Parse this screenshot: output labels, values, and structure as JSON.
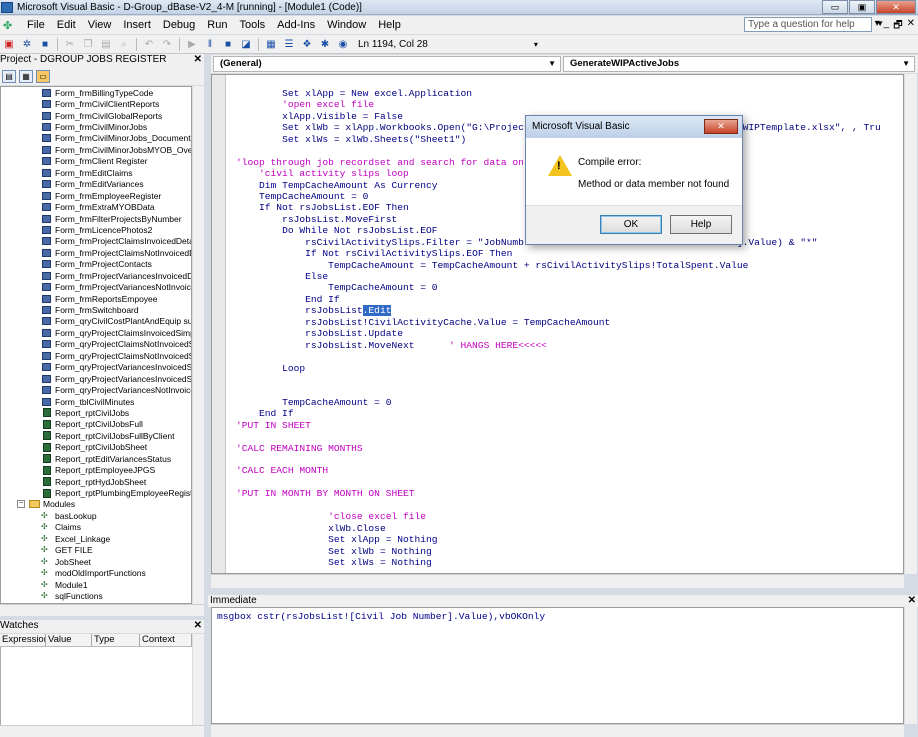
{
  "window": {
    "title": "Microsoft Visual Basic - D-Group_dBase-V2_4-M [running] - [Module1 (Code)]",
    "controls": [
      "▭",
      "▣",
      "✕"
    ]
  },
  "menu": {
    "items": [
      "File",
      "Edit",
      "View",
      "Insert",
      "Debug",
      "Run",
      "Tools",
      "Add-Ins",
      "Window",
      "Help"
    ],
    "ask_placeholder": "Type a question for help",
    "mdi_controls": [
      "▾",
      "_",
      "🗗",
      "✕"
    ]
  },
  "toolbar": {
    "position": "Ln 1194, Col 28"
  },
  "project": {
    "header": "Project - DGROUP JOBS REGISTER",
    "close": "✕",
    "forms": [
      "Form_frmBillingTypeCode",
      "Form_frmCivilClientReports",
      "Form_frmCivilGlobalReports",
      "Form_frmCivilMinorJobs",
      "Form_frmCivilMinorJobs_Documents",
      "Form_frmCivilMinorJobsMYOB_Overvie",
      "Form_frmClient Register",
      "Form_frmEditClaims",
      "Form_frmEditVariances",
      "Form_frmEmployeeRegister",
      "Form_frmExtraMYOBData",
      "Form_frmFilterProjectsByNumber",
      "Form_frmLicencePhotos2",
      "Form_frmProjectClaimsInvoicedDetail",
      "Form_frmProjectClaimsNotInvoicedDet",
      "Form_frmProjectContacts",
      "Form_frmProjectVariancesInvoicedDeta",
      "Form_frmProjectVariancesNotInvoicedI",
      "Form_frmReportsEmpoyee",
      "Form_frmSwitchboard",
      "Form_qryCivilCostPlantAndEquip subfo",
      "Form_qryProjectClaimsInvoicedSimple s",
      "Form_qryProjectClaimsNotInvoicedSimp",
      "Form_qryProjectClaimsNotInvoicedSwit",
      "Form_qryProjectVariancesInvoicedSimp",
      "Form_qryProjectVariancesInvoicedSimp",
      "Form_qryProjectVariancesNotInvoicedS",
      "Form_tblCivilMinutes"
    ],
    "reports": [
      "Report_rptCivilJobs",
      "Report_rptCivilJobsFull",
      "Report_rptCivilJobsFullByClient",
      "Report_rptCivilJobSheet",
      "Report_rptEditVariancesStatus",
      "Report_rptEmployeeJPGS",
      "Report_rptHydJobSheet",
      "Report_rptPlumbingEmployeeRegister"
    ],
    "modules_folder": "Modules",
    "modules": [
      "basLookup",
      "Claims",
      "Excel_Linkage",
      "GET FILE",
      "JobSheet",
      "modOldImportFunctions",
      "Module1",
      "sqlFunctions"
    ]
  },
  "watches": {
    "header": "Watches",
    "columns": [
      "Expression",
      "Value",
      "Type",
      "Context"
    ]
  },
  "code": {
    "object_combo": "(General)",
    "proc_combo": "GenerateWIPActiveJobs",
    "lines": [
      {
        "indent": 8,
        "parts": [
          {
            "t": "kw",
            "s": "Set "
          },
          {
            "t": "tx",
            "s": "xlApp = "
          },
          {
            "t": "kw",
            "s": "New "
          },
          {
            "t": "tx",
            "s": "excel.Application"
          }
        ]
      },
      {
        "indent": 8,
        "parts": [
          {
            "t": "cm",
            "s": "'open excel file"
          }
        ]
      },
      {
        "indent": 8,
        "parts": [
          {
            "t": "tx",
            "s": "xlApp.Visible = "
          },
          {
            "t": "kw",
            "s": "False"
          }
        ]
      },
      {
        "indent": 8,
        "parts": [
          {
            "t": "kw",
            "s": "Set "
          },
          {
            "t": "tx",
            "s": "xlWb = xlApp.Workbooks.Open(\"G:\\Project                                  es\\WIPTemplate.xlsx\", , Tru"
          }
        ]
      },
      {
        "indent": 8,
        "parts": [
          {
            "t": "kw",
            "s": "Set "
          },
          {
            "t": "tx",
            "s": "xlWs = xlWb.Sheets(\"Sheet1\")"
          }
        ]
      },
      {
        "indent": 0,
        "parts": []
      },
      {
        "indent": 0,
        "parts": [
          {
            "t": "cm",
            "s": "'loop through job recordset and search for data on"
          }
        ]
      },
      {
        "indent": 4,
        "parts": [
          {
            "t": "cm",
            "s": "'civil activity slips loop"
          }
        ]
      },
      {
        "indent": 4,
        "parts": [
          {
            "t": "kw",
            "s": "Dim "
          },
          {
            "t": "tx",
            "s": "TempCacheAmount "
          },
          {
            "t": "kw",
            "s": "As Currency"
          }
        ]
      },
      {
        "indent": 4,
        "parts": [
          {
            "t": "tx",
            "s": "TempCacheAmount = 0"
          }
        ]
      },
      {
        "indent": 4,
        "parts": [
          {
            "t": "kw",
            "s": "If Not "
          },
          {
            "t": "tx",
            "s": "rsJobsList.EOF "
          },
          {
            "t": "kw",
            "s": "Then"
          }
        ]
      },
      {
        "indent": 8,
        "parts": [
          {
            "t": "tx",
            "s": "rsJobsList.MoveFirst"
          }
        ]
      },
      {
        "indent": 8,
        "parts": [
          {
            "t": "kw",
            "s": "Do While Not "
          },
          {
            "t": "tx",
            "s": "rsJobsList.EOF"
          }
        ]
      },
      {
        "indent": 12,
        "parts": [
          {
            "t": "tx",
            "s": "rsCivilActivitySlips.Filter = \"JobNumb                            ob Number].Value) & \"*\""
          }
        ]
      },
      {
        "indent": 12,
        "parts": [
          {
            "t": "kw",
            "s": "If Not "
          },
          {
            "t": "tx",
            "s": "rsCivilActivitySlips.EOF "
          },
          {
            "t": "kw",
            "s": "Then"
          }
        ]
      },
      {
        "indent": 16,
        "parts": [
          {
            "t": "tx",
            "s": "TempCacheAmount = TempCacheAmount + rsCivilActivitySlips!TotalSpent.Value"
          }
        ]
      },
      {
        "indent": 12,
        "parts": [
          {
            "t": "kw",
            "s": "Else"
          }
        ]
      },
      {
        "indent": 16,
        "parts": [
          {
            "t": "tx",
            "s": "TempCacheAmount = 0"
          }
        ]
      },
      {
        "indent": 12,
        "parts": [
          {
            "t": "kw",
            "s": "End If"
          }
        ]
      },
      {
        "indent": 12,
        "parts": [
          {
            "t": "tx",
            "s": "rsJobsList"
          },
          {
            "t": "hl",
            "s": ".Edit"
          }
        ]
      },
      {
        "indent": 12,
        "parts": [
          {
            "t": "tx",
            "s": "rsJobsList!CivilActivityCache.Value = TempCacheAmount"
          }
        ]
      },
      {
        "indent": 12,
        "parts": [
          {
            "t": "tx",
            "s": "rsJobsList.Update"
          }
        ]
      },
      {
        "indent": 12,
        "parts": [
          {
            "t": "tx",
            "s": "rsJobsList.MoveNext      "
          },
          {
            "t": "cm",
            "s": "' HANGS HERE<<<<<"
          }
        ]
      },
      {
        "indent": 0,
        "parts": []
      },
      {
        "indent": 8,
        "parts": [
          {
            "t": "kw",
            "s": "Loop"
          }
        ]
      },
      {
        "indent": 0,
        "parts": []
      },
      {
        "indent": 0,
        "parts": []
      },
      {
        "indent": 8,
        "parts": [
          {
            "t": "tx",
            "s": "TempCacheAmount = 0"
          }
        ]
      },
      {
        "indent": 4,
        "parts": [
          {
            "t": "kw",
            "s": "End If"
          }
        ]
      },
      {
        "indent": 0,
        "parts": [
          {
            "t": "cm",
            "s": "'PUT IN SHEET"
          }
        ]
      },
      {
        "indent": 0,
        "parts": []
      },
      {
        "indent": 0,
        "parts": [
          {
            "t": "cm",
            "s": "'CALC REMAINING MONTHS"
          }
        ]
      },
      {
        "indent": 0,
        "parts": []
      },
      {
        "indent": 0,
        "parts": [
          {
            "t": "cm",
            "s": "'CALC EACH MONTH"
          }
        ]
      },
      {
        "indent": 0,
        "parts": []
      },
      {
        "indent": 0,
        "parts": [
          {
            "t": "cm",
            "s": "'PUT IN MONTH BY MONTH ON SHEET"
          }
        ]
      },
      {
        "indent": 0,
        "parts": []
      },
      {
        "indent": 16,
        "parts": [
          {
            "t": "cm",
            "s": "'close excel file"
          }
        ]
      },
      {
        "indent": 16,
        "parts": [
          {
            "t": "tx",
            "s": "xlWb.Close"
          }
        ]
      },
      {
        "indent": 16,
        "parts": [
          {
            "t": "kw",
            "s": "Set "
          },
          {
            "t": "tx",
            "s": "xlApp = "
          },
          {
            "t": "kw",
            "s": "Nothing"
          }
        ]
      },
      {
        "indent": 16,
        "parts": [
          {
            "t": "kw",
            "s": "Set "
          },
          {
            "t": "tx",
            "s": "xlWb = "
          },
          {
            "t": "kw",
            "s": "Nothing"
          }
        ]
      },
      {
        "indent": 16,
        "parts": [
          {
            "t": "kw",
            "s": "Set "
          },
          {
            "t": "tx",
            "s": "xlWs = "
          },
          {
            "t": "kw",
            "s": "Nothing"
          }
        ]
      }
    ]
  },
  "immediate": {
    "header": "Immediate",
    "content": "msgbox cstr(rsJobsList![Civil Job Number].Value),vbOKOnly"
  },
  "dialog": {
    "title": "Microsoft Visual Basic",
    "line1": "Compile error:",
    "line2": "Method or data member not found",
    "ok_label": "OK",
    "help_label": "Help"
  },
  "colors": {
    "keyword": "#00008b",
    "comment": "#c000c0",
    "selection": "#316ac5"
  }
}
